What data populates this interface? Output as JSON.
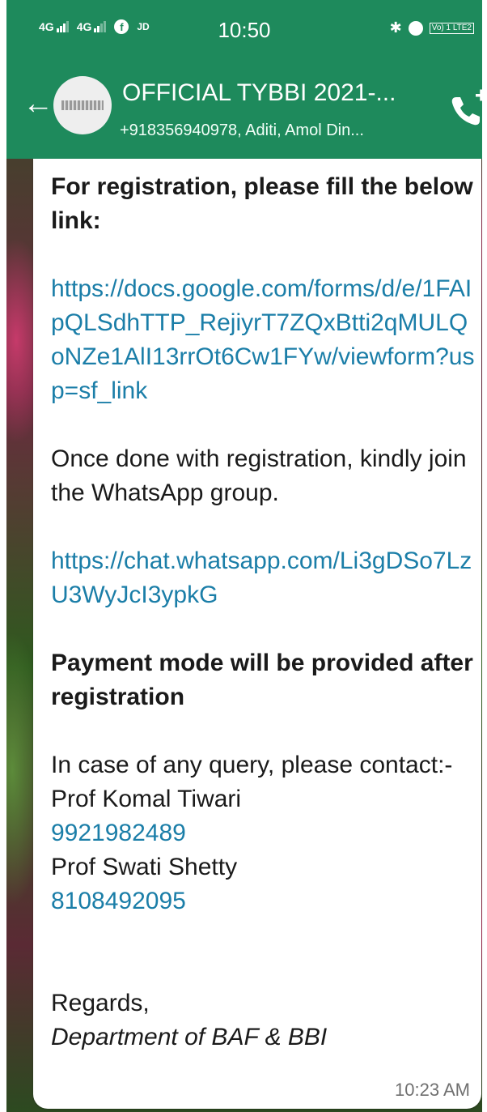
{
  "status_bar": {
    "network1": "4G",
    "network2": "4G",
    "app_label": "JD",
    "time": "10:50",
    "volte": "Vo) 1 LTE2"
  },
  "header": {
    "title": "OFFICIAL TYBBI 2021-...",
    "subtitle": "+918356940978, Aditi, Amol Din...",
    "back_icon": "arrow-left-icon",
    "call_icon": "add-call-icon"
  },
  "message": {
    "para1": "For registration, please  fill the below link:",
    "link1": "https://docs.google.com/forms/d/e/1FAIpQLSdhTTP_RejiyrT7ZQxBtti2qMULQoNZe1AlI13rrOt6Cw1FYw/viewform?usp=sf_link",
    "para2": "Once done with registration, kindly join the WhatsApp group.",
    "link2": "https://chat.whatsapp.com/Li3gDSo7LzU3WyJcI3ypkG",
    "para3": "Payment mode will be provided after registration",
    "contact_intro": "In case of any query, please contact:-",
    "contact1_name": "Prof Komal Tiwari",
    "contact1_phone": "9921982489",
    "contact2_name": "Prof Swati Shetty",
    "contact2_phone": "8108492095",
    "regards": "Regards,",
    "signature": "Department of BAF & BBI",
    "time": "10:23 AM"
  },
  "colors": {
    "header_green": "#1e8a5c",
    "link_blue": "#1b7ea8"
  }
}
